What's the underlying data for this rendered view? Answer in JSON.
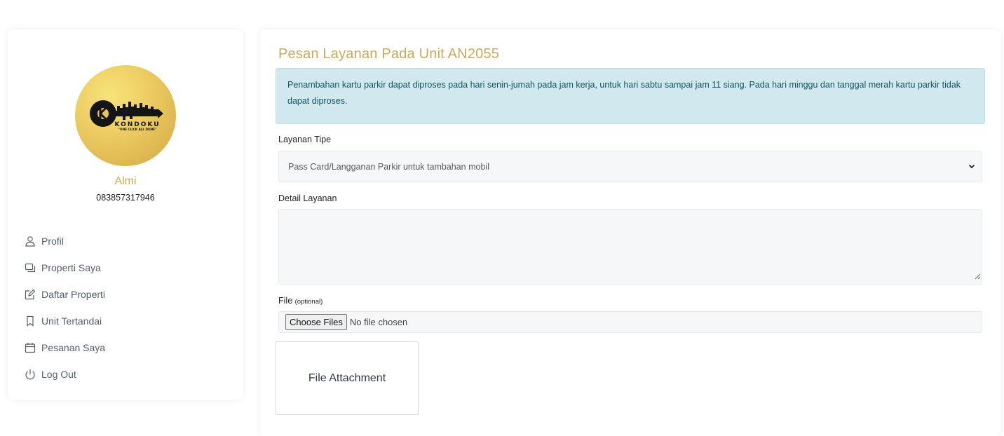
{
  "profile": {
    "logo_text": "KONDOKU",
    "logo_tagline": "\"ONE CLICK ALL DONE\"",
    "name": "Almi",
    "phone": "083857317946"
  },
  "menu": [
    {
      "label": "Profil",
      "icon": "user-icon"
    },
    {
      "label": "Properti Saya",
      "icon": "properties-icon"
    },
    {
      "label": "Daftar Properti",
      "icon": "edit-icon"
    },
    {
      "label": "Unit Tertandai",
      "icon": "bookmark-icon"
    },
    {
      "label": "Pesanan Saya",
      "icon": "calendar-icon"
    },
    {
      "label": "Log Out",
      "icon": "power-icon"
    }
  ],
  "form": {
    "title": "Pesan Layanan Pada Unit AN2055",
    "notice": "Penambahan kartu parkir dapat diproses pada hari senin-jumah pada jam kerja, untuk hari sabtu sampai jam 11 siang. Pada hari minggu dan tanggal merah kartu parkir tidak dapat diproses.",
    "service_type_label": "Layanan Tipe",
    "service_type_value": "Pass Card/Langganan Parkir untuk tambahan mobil",
    "detail_label": "Detail Layanan",
    "detail_value": "",
    "file_label": "File",
    "file_optional": "(optional)",
    "file_button": "Choose Files",
    "file_status": "No file chosen",
    "attachment_label": "File Attachment"
  },
  "colors": {
    "accent": "#c9a95c",
    "alert_bg": "#d1e9ee",
    "alert_text": "#10535f"
  }
}
